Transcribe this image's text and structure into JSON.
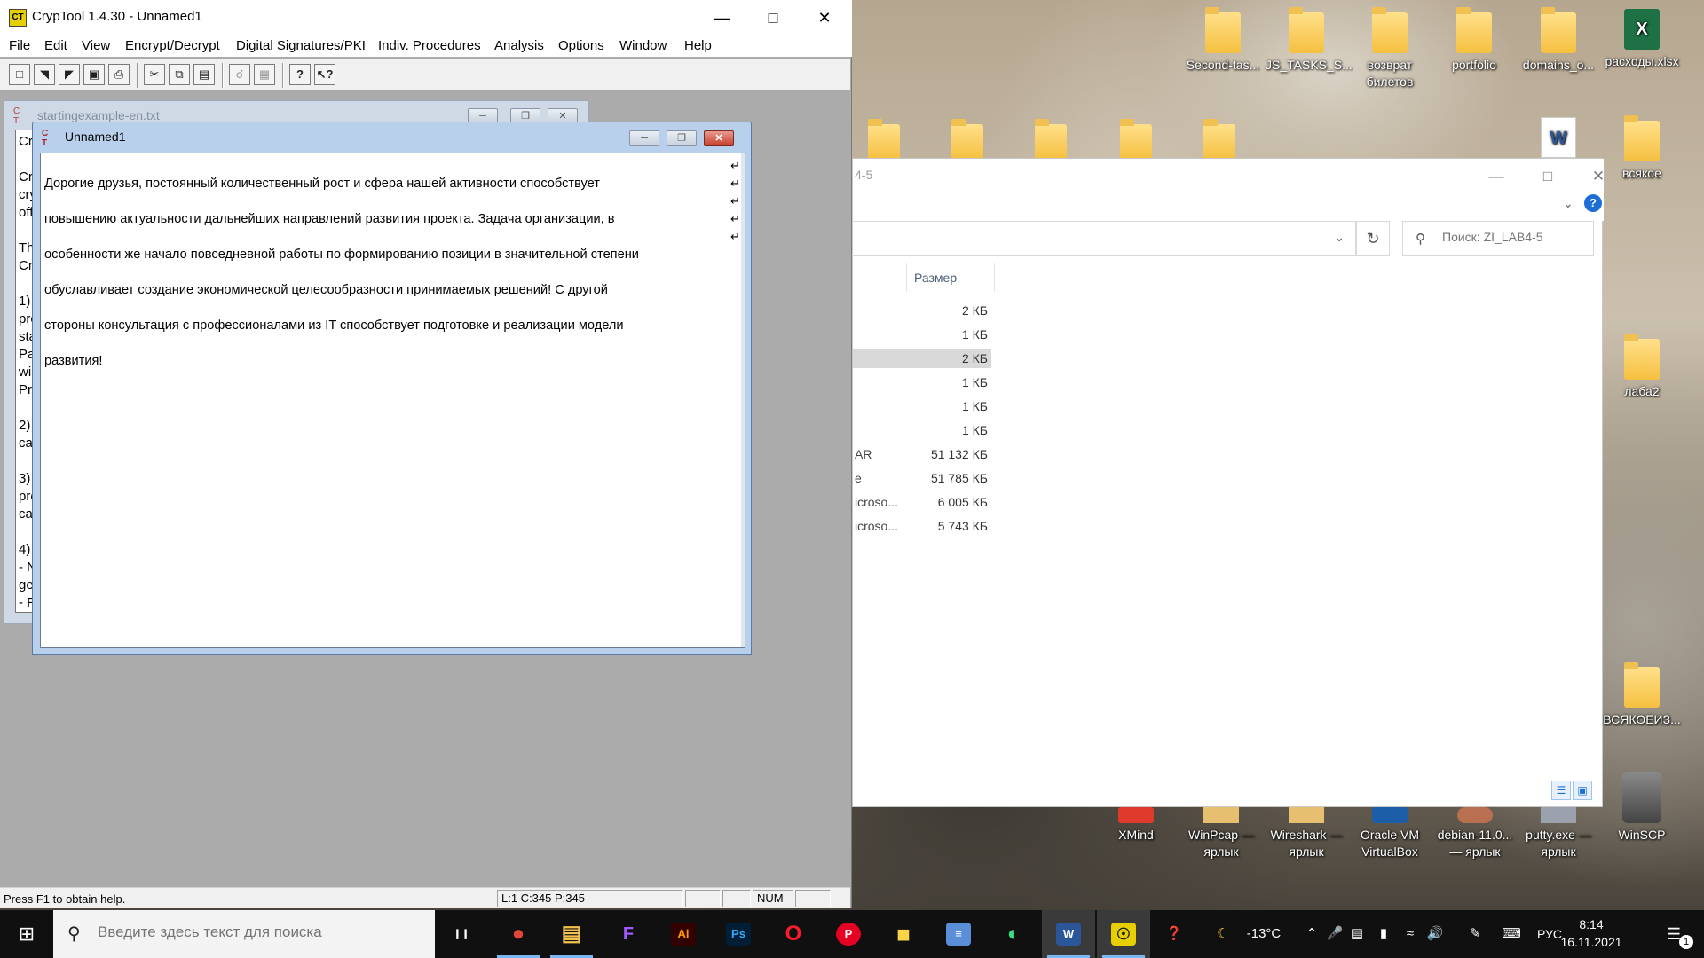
{
  "cryptool": {
    "app_icon": "cryptool-logo-icon",
    "title": "CrypTool 1.4.30 - Unnamed1",
    "menu": [
      "File",
      "Edit",
      "View",
      "Encrypt/Decrypt",
      "Digital Signatures/PKI",
      "Indiv. Procedures",
      "Analysis",
      "Options",
      "Window",
      "Help"
    ],
    "toolbar_icons": [
      "new-file-icon",
      "open-file-icon",
      "open-folder-icon",
      "save-icon",
      "print-icon",
      "cut-icon",
      "copy-icon",
      "paste-icon",
      "key-icon",
      "properties-icon",
      "help-icon",
      "context-help-icon"
    ],
    "child_inactive": {
      "title": "startingexample-en.txt",
      "visible_lines": [
        "Cr",
        "Cr",
        "cry",
        "off",
        "Th",
        "Cr",
        "1)",
        "pre",
        "sta",
        "Pa",
        "wi",
        "Pr",
        "2)",
        "ca",
        "3)",
        "pre",
        "ca",
        "4)",
        "- N",
        "ge",
        "- F"
      ]
    },
    "child_active": {
      "title": "Unnamed1",
      "lines": [
        "Дорогие друзья, постоянный количественный рост и сфера нашей активности способствует",
        "повышению актуальности дальнейших направлений развития проекта. Задача организации, в",
        "особенности же начало повседневной работы по формированию позиции в значительной степени",
        "обуславливает создание экономической целесообразности принимаемых решений! С другой",
        "стороны консультация с профессионалами из IT способствует подготовке и реализации модели",
        "развития!"
      ],
      "line_marks": [
        "↵",
        "↵",
        "↵",
        "↵",
        "↵"
      ]
    },
    "status": {
      "message": "Press F1 to obtain help.",
      "position": "L:1  C:345  P:345",
      "num": "NUM"
    }
  },
  "explorer": {
    "breadcrumb": "4-5",
    "search_placeholder": "Поиск: ZI_LAB4-5",
    "column_size": "Размер",
    "rows": [
      {
        "name": "",
        "size": "2 КБ",
        "selected": false
      },
      {
        "name": "",
        "size": "1 КБ",
        "selected": false
      },
      {
        "name": "",
        "size": "2 КБ",
        "selected": true
      },
      {
        "name": "",
        "size": "1 КБ",
        "selected": false
      },
      {
        "name": "",
        "size": "1 КБ",
        "selected": false
      },
      {
        "name": "",
        "size": "1 КБ",
        "selected": false
      },
      {
        "name": "AR",
        "size": "51 132 КБ",
        "selected": false
      },
      {
        "name": "e",
        "size": "51 785 КБ",
        "selected": false
      },
      {
        "name": "icroso...",
        "size": "6 005 КБ",
        "selected": false
      },
      {
        "name": "icroso...",
        "size": "5 743 КБ",
        "selected": false
      }
    ]
  },
  "desktop_icons": [
    {
      "label": "Second-tas...",
      "icon": "folder-icon"
    },
    {
      "label": "JS_TASKS_S...",
      "icon": "folder-icon"
    },
    {
      "label": "возврат билетов",
      "icon": "folder-icon"
    },
    {
      "label": "portfolio",
      "icon": "folder-icon"
    },
    {
      "label": "domains_o...",
      "icon": "folder-icon"
    },
    {
      "label": "расходы.xlsx",
      "icon": "excel-icon"
    },
    {
      "label": "",
      "icon": "word-icon"
    },
    {
      "label": "всякое",
      "icon": "folder-icon"
    },
    {
      "label": "лаба2",
      "icon": "folder-icon"
    },
    {
      "label": "ВСЯКОЕИЗ...",
      "icon": "folder-icon"
    },
    {
      "label": "XMind",
      "icon": "xmind-icon"
    },
    {
      "label": "WinPcap — ярлык",
      "icon": "shortcut-icon"
    },
    {
      "label": "Wireshark — ярлык",
      "icon": "shortcut-icon"
    },
    {
      "label": "Oracle VM VirtualBox",
      "icon": "virtualbox-icon"
    },
    {
      "label": "debian-11.0... — ярлык",
      "icon": "shortcut-icon"
    },
    {
      "label": "putty.exe — ярлык",
      "icon": "shortcut-icon"
    },
    {
      "label": "WinSCP",
      "icon": "winscp-icon"
    }
  ],
  "taskbar": {
    "search_placeholder": "Введите здесь текст для поиска",
    "apps": [
      {
        "name": "task-view-icon",
        "glyph": "❙❙"
      },
      {
        "name": "chrome-icon",
        "glyph": "●",
        "color": "#e0463a"
      },
      {
        "name": "file-explorer-icon",
        "glyph": "▤",
        "color": "#f2c14e"
      },
      {
        "name": "figma-icon",
        "glyph": "F",
        "color": "#a259ff"
      },
      {
        "name": "illustrator-icon",
        "glyph": "Ai",
        "color": "#ff9a00"
      },
      {
        "name": "photoshop-icon",
        "glyph": "Ps",
        "color": "#31a8ff"
      },
      {
        "name": "opera-icon",
        "glyph": "O",
        "color": "#ff1b2d"
      },
      {
        "name": "pinterest-icon",
        "glyph": "P",
        "color": "#e60023"
      },
      {
        "name": "sticky-notes-icon",
        "glyph": "■",
        "color": "#f8d548"
      },
      {
        "name": "calculator-icon",
        "glyph": "≡",
        "color": "#5a8fd8"
      },
      {
        "name": "android-studio-icon",
        "glyph": "◐",
        "color": "#3ddc84"
      },
      {
        "name": "word-icon",
        "glyph": "W",
        "color": "#2b579a"
      },
      {
        "name": "cryptool-icon",
        "glyph": "☉",
        "color": "#e8d000"
      }
    ],
    "tray": {
      "weather": "-13°C",
      "language": "РУС",
      "time": "8:14",
      "date": "16.11.2021",
      "notification_count": "1"
    }
  }
}
